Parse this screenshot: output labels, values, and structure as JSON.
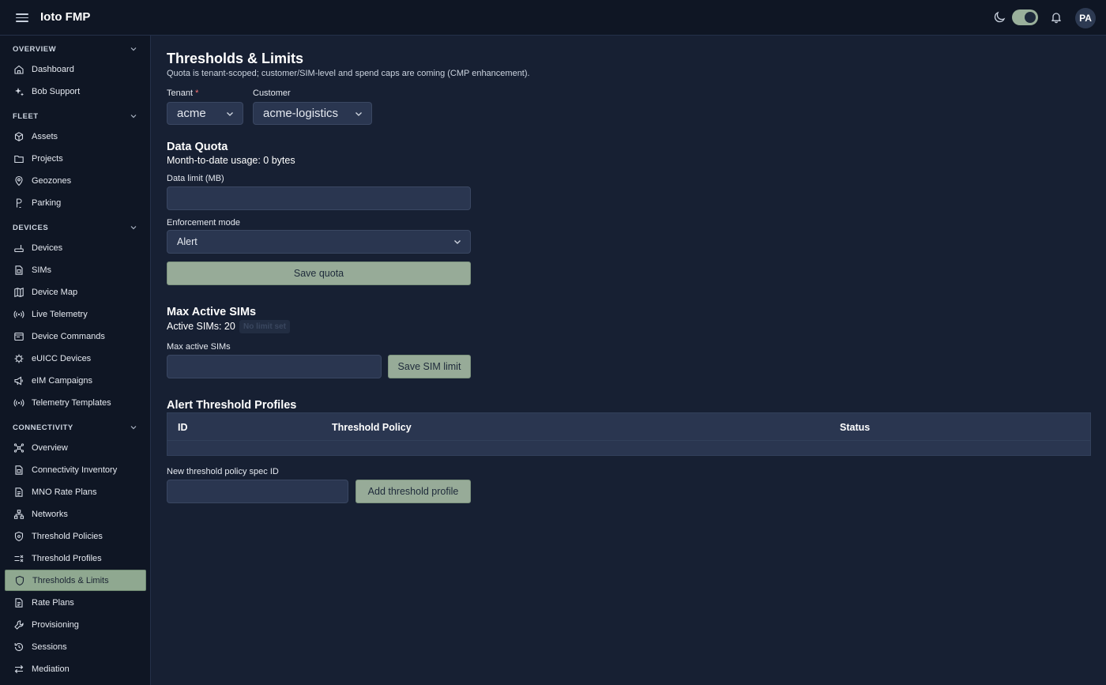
{
  "app": {
    "title": "Ioto FMP",
    "avatar_initials": "PA",
    "accent_color": "#8fa890",
    "background": "#172033"
  },
  "header_icons": [
    "menu-icon",
    "moon-icon",
    "theme-toggle",
    "bell-icon"
  ],
  "sidebar": {
    "sections": [
      {
        "label": "OVERVIEW",
        "items": [
          {
            "label": "Dashboard",
            "icon": "home-icon"
          },
          {
            "label": "Bob Support",
            "icon": "sparkle-icon"
          }
        ]
      },
      {
        "label": "FLEET",
        "items": [
          {
            "label": "Assets",
            "icon": "box-icon"
          },
          {
            "label": "Projects",
            "icon": "folder-icon"
          },
          {
            "label": "Geozones",
            "icon": "map-pin-icon"
          },
          {
            "label": "Parking",
            "icon": "parking-icon"
          }
        ]
      },
      {
        "label": "DEVICES",
        "items": [
          {
            "label": "Devices",
            "icon": "router-icon"
          },
          {
            "label": "SIMs",
            "icon": "sim-icon"
          },
          {
            "label": "Device Map",
            "icon": "map-icon"
          },
          {
            "label": "Live Telemetry",
            "icon": "signal-icon"
          },
          {
            "label": "Device Commands",
            "icon": "terminal-icon"
          },
          {
            "label": "eUICC Devices",
            "icon": "chip-icon"
          },
          {
            "label": "eIM Campaigns",
            "icon": "megaphone-icon"
          },
          {
            "label": "Telemetry Templates",
            "icon": "signal-icon"
          }
        ]
      },
      {
        "label": "CONNECTIVITY",
        "items": [
          {
            "label": "Overview",
            "icon": "network-icon"
          },
          {
            "label": "Connectivity Inventory",
            "icon": "sim-icon"
          },
          {
            "label": "MNO Rate Plans",
            "icon": "document-icon"
          },
          {
            "label": "Networks",
            "icon": "hierarchy-icon"
          },
          {
            "label": "Threshold Policies",
            "icon": "shield-gear-icon"
          },
          {
            "label": "Threshold Profiles",
            "icon": "list-check-icon"
          },
          {
            "label": "Thresholds & Limits",
            "icon": "shield-icon",
            "active": true
          },
          {
            "label": "Rate Plans",
            "icon": "document-icon"
          },
          {
            "label": "Provisioning",
            "icon": "wrench-icon"
          },
          {
            "label": "Sessions",
            "icon": "history-icon"
          },
          {
            "label": "Mediation",
            "icon": "swap-icon"
          }
        ]
      }
    ]
  },
  "page": {
    "title": "Thresholds & Limits",
    "subtitle": "Quota is tenant-scoped; customer/SIM-level and spend caps are coming (CMP enhancement).",
    "tenant": {
      "label": "Tenant",
      "required_mark": "*",
      "value": "acme"
    },
    "customer": {
      "label": "Customer",
      "value": "acme-logistics"
    },
    "data_quota": {
      "title": "Data Quota",
      "usage": "Month-to-date usage: 0 bytes",
      "limit_label": "Data limit (MB)",
      "limit_value": "",
      "mode_label": "Enforcement mode",
      "mode_value": "Alert",
      "save_label": "Save quota"
    },
    "max_sims": {
      "title": "Max Active SIMs",
      "active_text": "Active SIMs: 20",
      "badge": "No limit set",
      "input_label": "Max active SIMs",
      "input_value": "",
      "save_label": "Save SIM limit"
    },
    "profiles": {
      "title": "Alert Threshold Profiles",
      "columns": [
        "ID",
        "Threshold Policy",
        "Status"
      ],
      "rows": [],
      "new_label": "New threshold policy spec ID",
      "new_value": "",
      "add_label": "Add threshold profile"
    }
  }
}
